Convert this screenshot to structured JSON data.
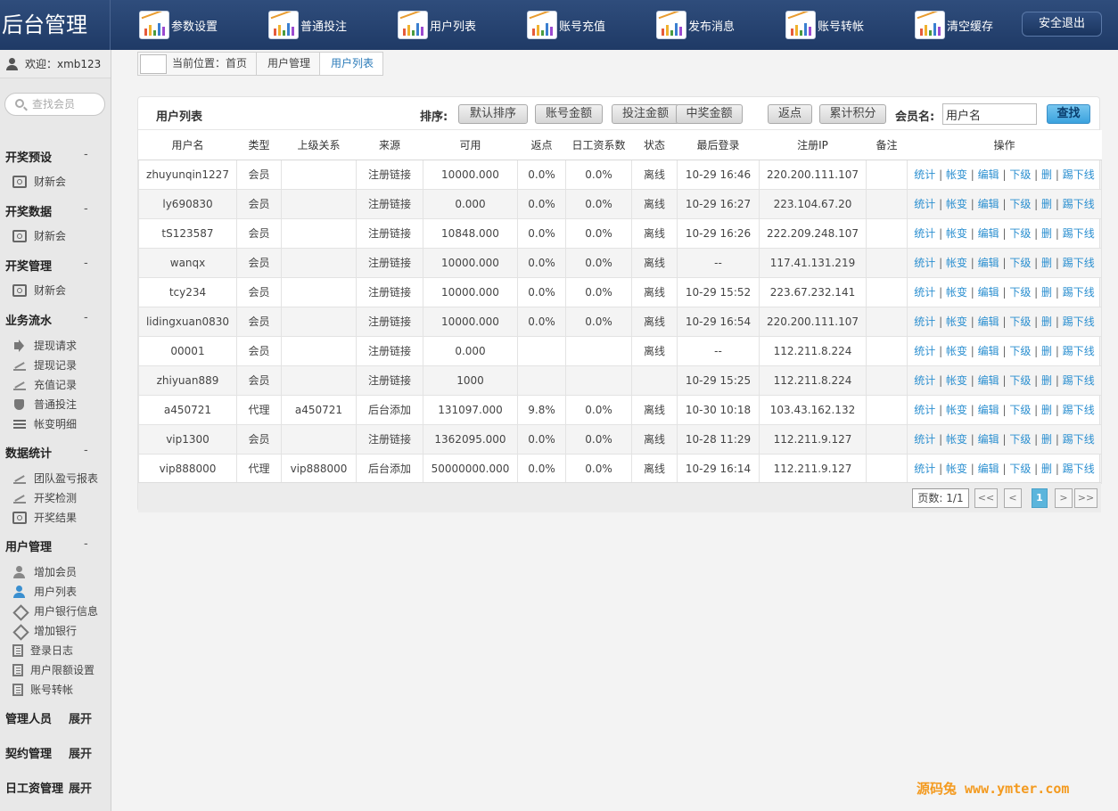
{
  "app": {
    "title": "后台管理"
  },
  "topnav": [
    {
      "label": "参数设置",
      "icon": "chart-icon"
    },
    {
      "label": "普通投注",
      "icon": "chart-icon"
    },
    {
      "label": "用户列表",
      "icon": "chart-icon"
    },
    {
      "label": "账号充值",
      "icon": "chart-icon"
    },
    {
      "label": "发布消息",
      "icon": "chart-icon"
    },
    {
      "label": "账号转帐",
      "icon": "chart-icon"
    },
    {
      "label": "清空缓存",
      "icon": "chart-icon"
    }
  ],
  "logout_label": "安全退出",
  "sidebar": {
    "welcome": "欢迎：xmb123",
    "search_placeholder": "查找会员",
    "sections": [
      {
        "title": "开奖预设",
        "toggle": "-",
        "items": [
          {
            "label": "财新会",
            "icon": "target-icon"
          }
        ]
      },
      {
        "title": "开奖数据",
        "toggle": "-",
        "items": [
          {
            "label": "财新会",
            "icon": "target-icon"
          }
        ]
      },
      {
        "title": "开奖管理",
        "toggle": "-",
        "items": [
          {
            "label": "财新会",
            "icon": "target-icon"
          }
        ]
      },
      {
        "title": "业务流水",
        "toggle": "-",
        "items": [
          {
            "label": "提现请求",
            "icon": "speaker-icon"
          },
          {
            "label": "提现记录",
            "icon": "chart-icon"
          },
          {
            "label": "充值记录",
            "icon": "chart-icon"
          },
          {
            "label": "普通投注",
            "icon": "shield-icon"
          },
          {
            "label": "帐变明细",
            "icon": "list-icon"
          }
        ]
      },
      {
        "title": "数据统计",
        "toggle": "-",
        "items": [
          {
            "label": "团队盈亏报表",
            "icon": "chart-icon"
          },
          {
            "label": "开奖检测",
            "icon": "chart-icon"
          },
          {
            "label": "开奖结果",
            "icon": "target-icon"
          }
        ]
      },
      {
        "title": "用户管理",
        "toggle": "-",
        "items": [
          {
            "label": "增加会员",
            "icon": "user-add-icon"
          },
          {
            "label": "用户列表",
            "icon": "user-icon"
          },
          {
            "label": "用户银行信息",
            "icon": "diamond-icon"
          },
          {
            "label": "增加银行",
            "icon": "diamond-icon"
          },
          {
            "label": "登录日志",
            "icon": "doc-icon"
          },
          {
            "label": "用户限额设置",
            "icon": "doc-icon"
          },
          {
            "label": "账号转帐",
            "icon": "doc-icon"
          }
        ]
      },
      {
        "title": "管理人员",
        "toggle": "展开",
        "items": []
      },
      {
        "title": "契约管理",
        "toggle": "展开",
        "items": []
      },
      {
        "title": "日工资管理",
        "toggle": "展开",
        "items": []
      }
    ]
  },
  "breadcrumb": [
    "当前位置：首页",
    "用户管理",
    "用户列表"
  ],
  "panel": {
    "title": "用户列表",
    "sort_label": "排序:",
    "sort_buttons": [
      "默认排序",
      "账号金额",
      "投注金额",
      "中奖金额",
      "返点",
      "累计积分"
    ],
    "member_label": "会员名:",
    "member_value": "用户名",
    "find_label": "查找"
  },
  "table": {
    "headers": [
      "用户名",
      "类型",
      "上级关系",
      "来源",
      "可用",
      "返点",
      "日工资系数",
      "状态",
      "最后登录",
      "注册IP",
      "备注",
      "操作"
    ],
    "ops": [
      "统计",
      "帐变",
      "编辑",
      "下级",
      "删",
      "踢下线"
    ],
    "rows": [
      [
        "zhuyunqin1227",
        "会员",
        "",
        "注册链接",
        "10000.000",
        "0.0%",
        "0.0%",
        "离线",
        "10-29 16:46",
        "220.200.111.107",
        ""
      ],
      [
        "ly690830",
        "会员",
        "",
        "注册链接",
        "0.000",
        "0.0%",
        "0.0%",
        "离线",
        "10-29 16:27",
        "223.104.67.20",
        ""
      ],
      [
        "tS123587",
        "会员",
        "",
        "注册链接",
        "10848.000",
        "0.0%",
        "0.0%",
        "离线",
        "10-29 16:26",
        "222.209.248.107",
        ""
      ],
      [
        "wanqx",
        "会员",
        "",
        "注册链接",
        "10000.000",
        "0.0%",
        "0.0%",
        "离线",
        "--",
        "117.41.131.219",
        ""
      ],
      [
        "tcy234",
        "会员",
        "",
        "注册链接",
        "10000.000",
        "0.0%",
        "0.0%",
        "离线",
        "10-29 15:52",
        "223.67.232.141",
        ""
      ],
      [
        "lidingxuan0830",
        "会员",
        "",
        "注册链接",
        "10000.000",
        "0.0%",
        "0.0%",
        "离线",
        "10-29 16:54",
        "220.200.111.107",
        ""
      ],
      [
        "00001",
        "会员",
        "",
        "注册链接",
        "0.000",
        "",
        "",
        "离线",
        "--",
        "112.211.8.224",
        ""
      ],
      [
        "zhiyuan889",
        "会员",
        "",
        "注册链接",
        "1000",
        "",
        "",
        "",
        "10-29 15:25",
        "112.211.8.224",
        ""
      ],
      [
        "a450721",
        "代理",
        "a450721",
        "后台添加",
        "131097.000",
        "9.8%",
        "0.0%",
        "离线",
        "10-30 10:18",
        "103.43.162.132",
        ""
      ],
      [
        "vip1300",
        "会员",
        "",
        "注册链接",
        "1362095.000",
        "0.0%",
        "0.0%",
        "离线",
        "10-28 11:29",
        "112.211.9.127",
        ""
      ],
      [
        "vip888000",
        "代理",
        "vip888000",
        "后台添加",
        "50000000.000",
        "0.0%",
        "0.0%",
        "离线",
        "10-29 16:14",
        "112.211.9.127",
        ""
      ]
    ]
  },
  "pager": {
    "info": "页数: 1/1",
    "buttons": [
      "<<",
      "<",
      "1",
      ">",
      ">>"
    ],
    "current": "1"
  },
  "watermark": "源码兔 www.ymter.com",
  "colors": {
    "topbar": "#1f3a66",
    "accent": "#3aa2de",
    "link": "#2b8fd0",
    "watermark": "#f39a1f"
  }
}
